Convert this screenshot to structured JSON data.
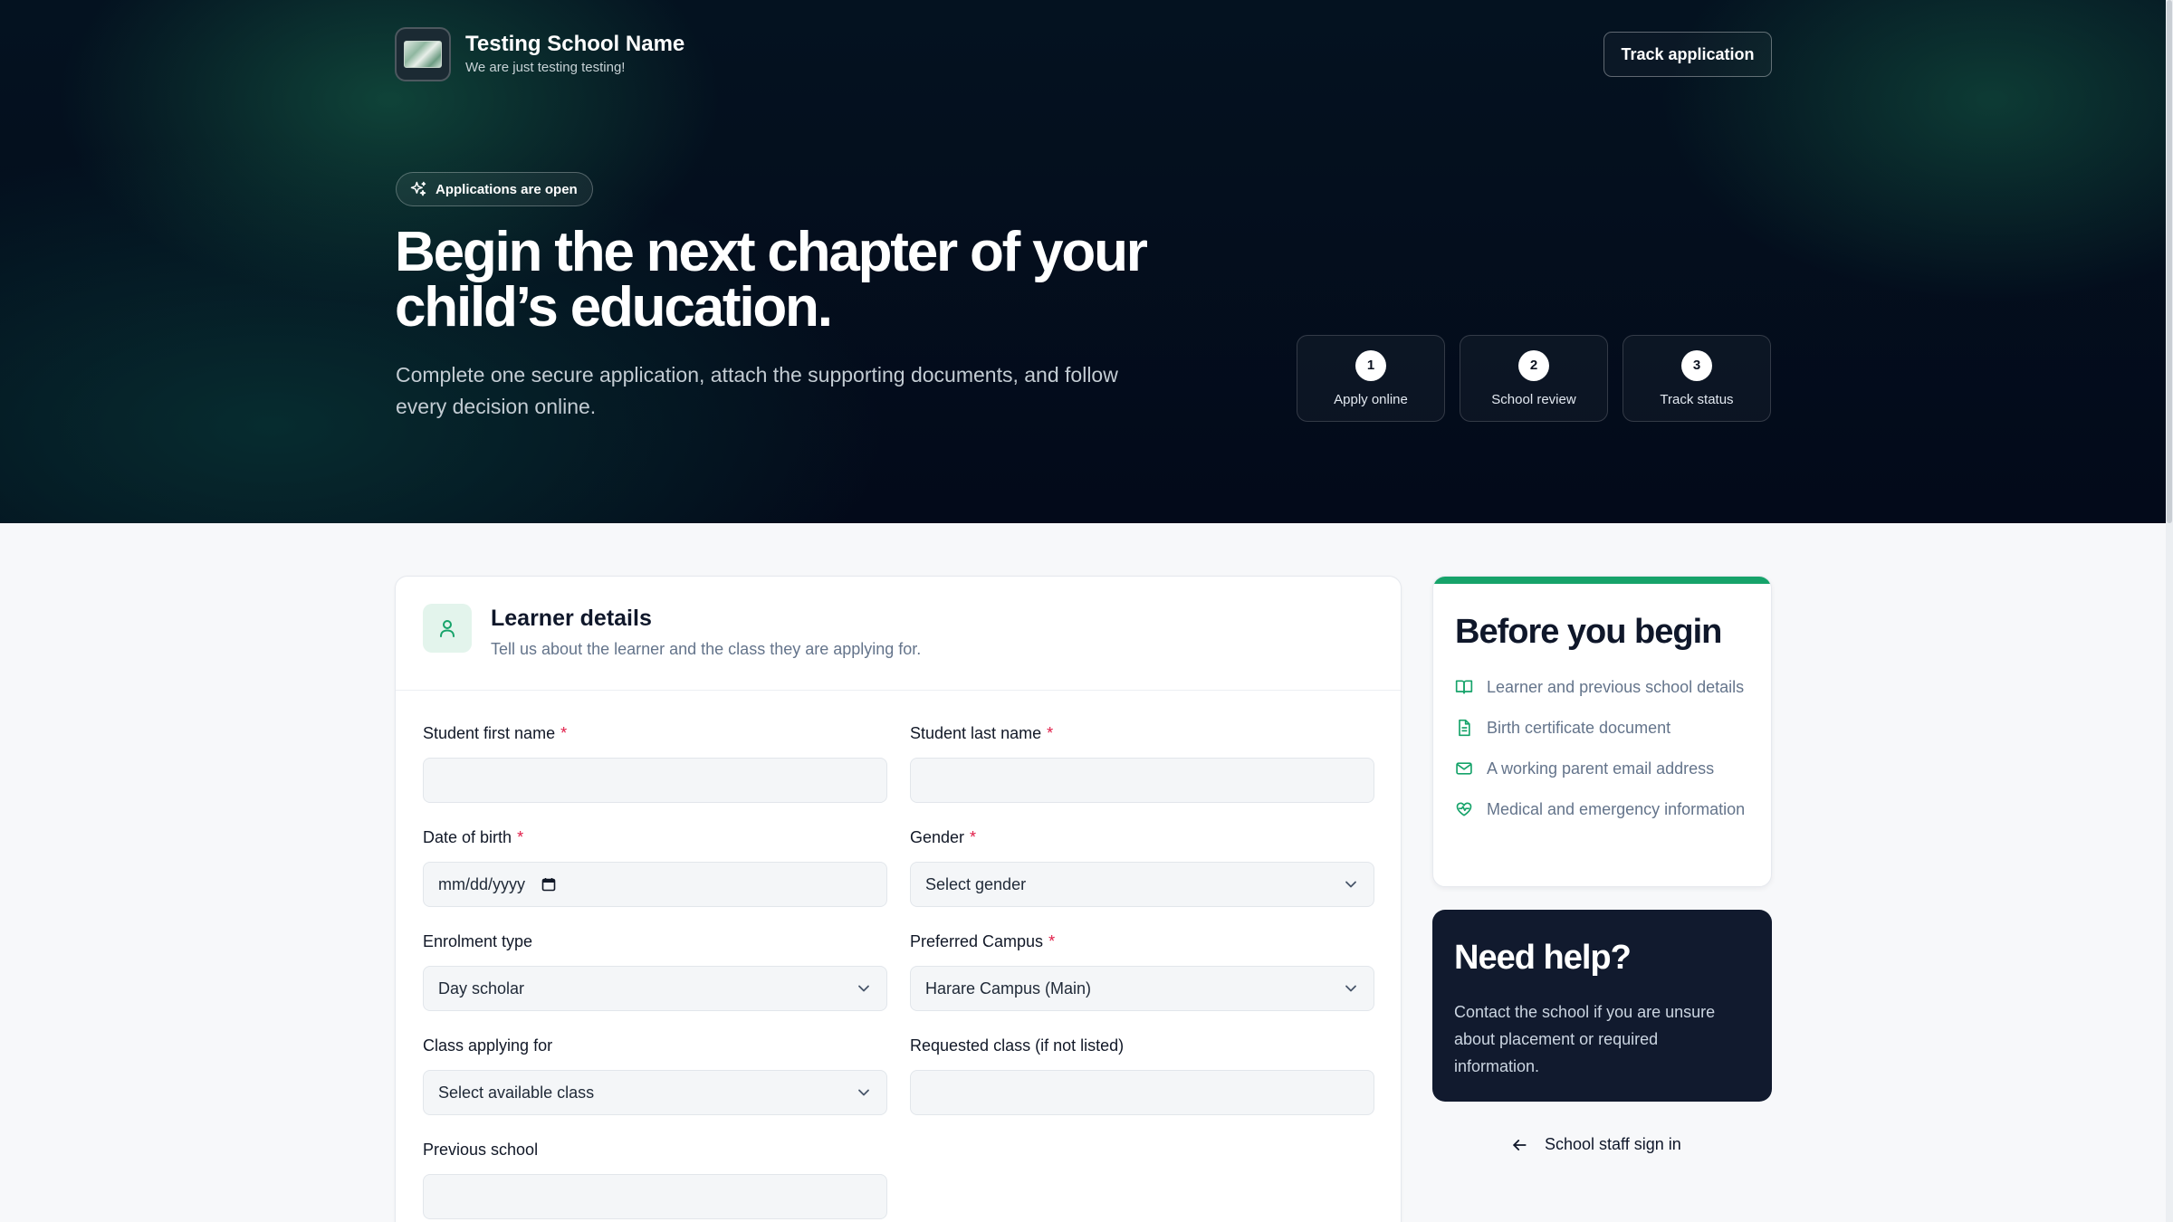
{
  "header": {
    "school_name": "Testing School Name",
    "tagline": "We are just testing testing!",
    "track_button": "Track application"
  },
  "hero": {
    "badge": "Applications are open",
    "title": "Begin the next chapter of your child’s education.",
    "subtitle": "Complete one secure application, attach the supporting documents, and follow every decision online.",
    "steps": [
      {
        "num": "1",
        "label": "Apply online"
      },
      {
        "num": "2",
        "label": "School review"
      },
      {
        "num": "3",
        "label": "Track status"
      }
    ]
  },
  "form": {
    "title": "Learner details",
    "description": "Tell us about the learner and the class they are applying for.",
    "required_mark": "*",
    "fields": {
      "first_name": {
        "label": "Student first name",
        "value": ""
      },
      "last_name": {
        "label": "Student last name",
        "value": ""
      },
      "dob": {
        "label": "Date of birth",
        "value": "mm/dd/yyyy"
      },
      "gender": {
        "label": "Gender",
        "value": "Select gender"
      },
      "enrolment": {
        "label": "Enrolment type",
        "value": "Day scholar"
      },
      "campus": {
        "label": "Preferred Campus",
        "value": "Harare Campus (Main)"
      },
      "class": {
        "label": "Class applying for",
        "value": "Select available class"
      },
      "requested_class": {
        "label": "Requested class (if not listed)",
        "value": ""
      },
      "previous_school": {
        "label": "Previous school",
        "value": ""
      }
    }
  },
  "sidebar": {
    "begin_title": "Before you begin",
    "items": [
      {
        "icon": "book-icon",
        "text": "Learner and previous school details"
      },
      {
        "icon": "document-icon",
        "text": "Birth certificate document"
      },
      {
        "icon": "mail-icon",
        "text": "A working parent email address"
      },
      {
        "icon": "heart-pulse-icon",
        "text": "Medical and emergency information"
      }
    ],
    "help_title": "Need help?",
    "help_text": "Contact the school if you are unsure about placement or required information.",
    "staff_link": "School staff sign in"
  },
  "colors": {
    "accent": "#16a36a",
    "hero_bg": "#030a1a",
    "help_bg": "#111a2e",
    "required": "#e11d48"
  }
}
